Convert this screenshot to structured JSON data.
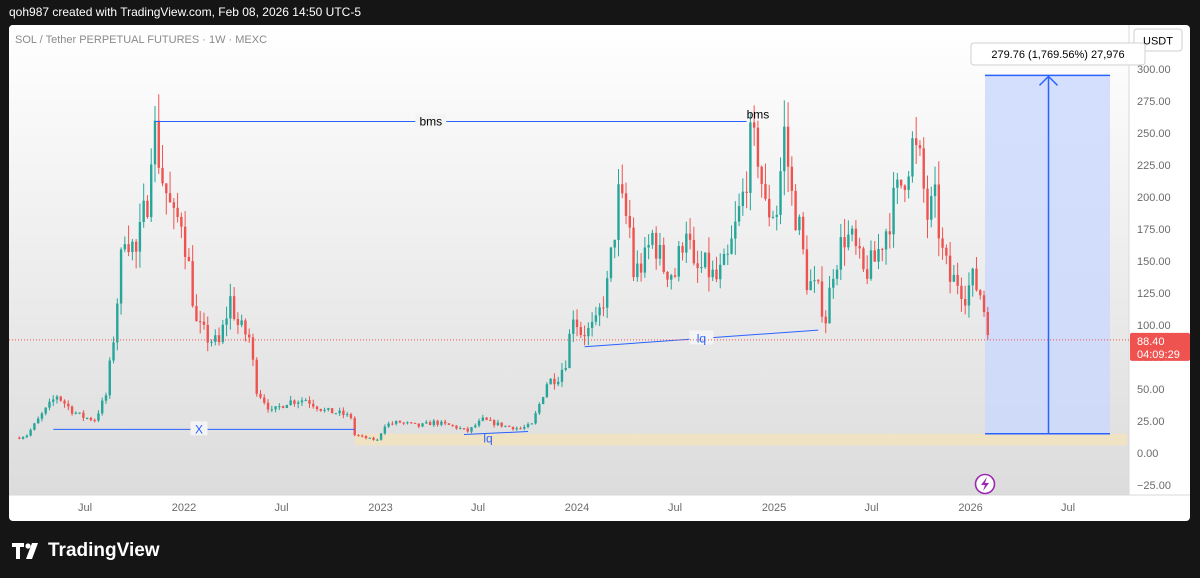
{
  "header": {
    "attribution": "qoh987 created with TradingView.com, Feb 08, 2026 14:50 UTC-5"
  },
  "footer": {
    "brand": "TradingView"
  },
  "chart_data": {
    "type": "candlestick",
    "title": "SOL / Tether PERPETUAL FUTURES · 1W · MEXC",
    "currency": "USDT",
    "ylim": [
      -35,
      310
    ],
    "y_ticks": [
      "300.00",
      "275.00",
      "250.00",
      "225.00",
      "200.00",
      "175.00",
      "150.00",
      "125.00",
      "100.00",
      "75.00",
      "50.00",
      "25.00",
      "0.00",
      "−25.00"
    ],
    "x_ticks": [
      {
        "label": "Jul",
        "date": "2021-07-01"
      },
      {
        "label": "2022",
        "date": "2022-01-01"
      },
      {
        "label": "Jul",
        "date": "2022-07-01"
      },
      {
        "label": "2023",
        "date": "2023-01-01"
      },
      {
        "label": "Jul",
        "date": "2023-07-01"
      },
      {
        "label": "2024",
        "date": "2024-01-01"
      },
      {
        "label": "Jul",
        "date": "2024-07-01"
      },
      {
        "label": "2025",
        "date": "2025-01-01"
      },
      {
        "label": "Jul",
        "date": "2025-07-01"
      },
      {
        "label": "2026",
        "date": "2026-01-01"
      },
      {
        "label": "Jul",
        "date": "2026-07-01"
      }
    ],
    "price_path": [
      [
        "2021-03-01",
        12
      ],
      [
        "2021-03-15",
        14
      ],
      [
        "2021-04-12",
        30
      ],
      [
        "2021-05-10",
        45
      ],
      [
        "2021-06-07",
        33
      ],
      [
        "2021-06-28",
        28
      ],
      [
        "2021-07-19",
        26
      ],
      [
        "2021-08-09",
        45
      ],
      [
        "2021-08-23",
        90
      ],
      [
        "2021-09-06",
        150
      ],
      [
        "2021-09-13",
        175
      ],
      [
        "2021-10-04",
        155
      ],
      [
        "2021-10-25",
        200
      ],
      [
        "2021-11-01",
        245
      ],
      [
        "2021-11-08",
        250
      ],
      [
        "2021-11-22",
        215
      ],
      [
        "2021-12-13",
        180
      ],
      [
        "2021-12-27",
        185
      ],
      [
        "2022-01-10",
        145
      ],
      [
        "2022-01-24",
        100
      ],
      [
        "2022-02-14",
        90
      ],
      [
        "2022-03-07",
        85
      ],
      [
        "2022-03-28",
        120
      ],
      [
        "2022-04-11",
        100
      ],
      [
        "2022-05-02",
        90
      ],
      [
        "2022-05-16",
        50
      ],
      [
        "2022-06-13",
        32
      ],
      [
        "2022-07-11",
        40
      ],
      [
        "2022-08-15",
        42
      ],
      [
        "2022-09-19",
        33
      ],
      [
        "2022-10-17",
        31
      ],
      [
        "2022-11-07",
        28
      ],
      [
        "2022-11-14",
        14
      ],
      [
        "2022-12-12",
        11
      ],
      [
        "2022-12-26",
        10
      ],
      [
        "2023-01-09",
        22
      ],
      [
        "2023-02-06",
        24
      ],
      [
        "2023-03-13",
        21
      ],
      [
        "2023-04-10",
        24
      ],
      [
        "2023-05-15",
        21
      ],
      [
        "2023-06-12",
        17
      ],
      [
        "2023-07-10",
        26
      ],
      [
        "2023-07-24",
        24
      ],
      [
        "2023-08-21",
        21
      ],
      [
        "2023-09-18",
        19
      ],
      [
        "2023-10-09",
        22
      ],
      [
        "2023-10-23",
        38
      ],
      [
        "2023-11-06",
        55
      ],
      [
        "2023-11-27",
        60
      ],
      [
        "2023-12-11",
        72
      ],
      [
        "2023-12-25",
        110
      ],
      [
        "2024-01-08",
        95
      ],
      [
        "2024-01-22",
        95
      ],
      [
        "2024-02-05",
        100
      ],
      [
        "2024-02-26",
        130
      ],
      [
        "2024-03-11",
        175
      ],
      [
        "2024-03-18",
        200
      ],
      [
        "2024-04-08",
        175
      ],
      [
        "2024-04-15",
        140
      ],
      [
        "2024-05-06",
        150
      ],
      [
        "2024-05-20",
        170
      ],
      [
        "2024-06-10",
        145
      ],
      [
        "2024-07-01",
        140
      ],
      [
        "2024-07-22",
        180
      ],
      [
        "2024-08-05",
        140
      ],
      [
        "2024-08-26",
        145
      ],
      [
        "2024-09-16",
        135
      ],
      [
        "2024-10-07",
        150
      ],
      [
        "2024-10-21",
        175
      ],
      [
        "2024-11-04",
        200
      ],
      [
        "2024-11-18",
        240
      ],
      [
        "2024-12-02",
        235
      ],
      [
        "2024-12-16",
        190
      ],
      [
        "2025-01-06",
        190
      ],
      [
        "2025-01-20",
        250
      ],
      [
        "2025-02-03",
        200
      ],
      [
        "2025-02-17",
        175
      ],
      [
        "2025-03-03",
        135
      ],
      [
        "2025-03-24",
        125
      ],
      [
        "2025-04-07",
        105
      ],
      [
        "2025-04-21",
        145
      ],
      [
        "2025-05-12",
        170
      ],
      [
        "2025-05-26",
        165
      ],
      [
        "2025-06-16",
        140
      ],
      [
        "2025-07-07",
        150
      ],
      [
        "2025-07-28",
        175
      ],
      [
        "2025-08-11",
        195
      ],
      [
        "2025-08-25",
        210
      ],
      [
        "2025-09-15",
        240
      ],
      [
        "2025-09-29",
        225
      ],
      [
        "2025-10-13",
        185
      ],
      [
        "2025-10-27",
        195
      ],
      [
        "2025-11-10",
        155
      ],
      [
        "2025-11-24",
        135
      ],
      [
        "2025-12-08",
        135
      ],
      [
        "2025-12-22",
        125
      ],
      [
        "2026-01-05",
        135
      ],
      [
        "2026-01-19",
        125
      ],
      [
        "2026-02-02",
        100
      ],
      [
        "2026-02-08",
        88.4
      ]
    ],
    "last_price": "88.40",
    "countdown": "04:09:29",
    "annotations": {
      "bms_label_1": "bms",
      "bms_label_2": "bms",
      "lq_label_1": "lq",
      "lq_label_2": "lq",
      "x_label": "X",
      "measure_label": "279.76 (1,769.56%) 27,976",
      "bms_line_price": 259,
      "lq_2024_start": [
        83,
        "2024-01-15"
      ],
      "lq_2024_end": [
        96,
        "2025-03-24"
      ],
      "x_line_price": 18.5,
      "measure_range": [
        15,
        295
      ],
      "demand_zone": [
        6,
        15
      ]
    },
    "colors": {
      "up": "#26a69a",
      "down": "#ef5350",
      "annotation_line": "#2962ff",
      "measure_fill": "#c9d8fc",
      "zone_fill": "#f0e3c4",
      "price_line": "#ef5350"
    }
  }
}
